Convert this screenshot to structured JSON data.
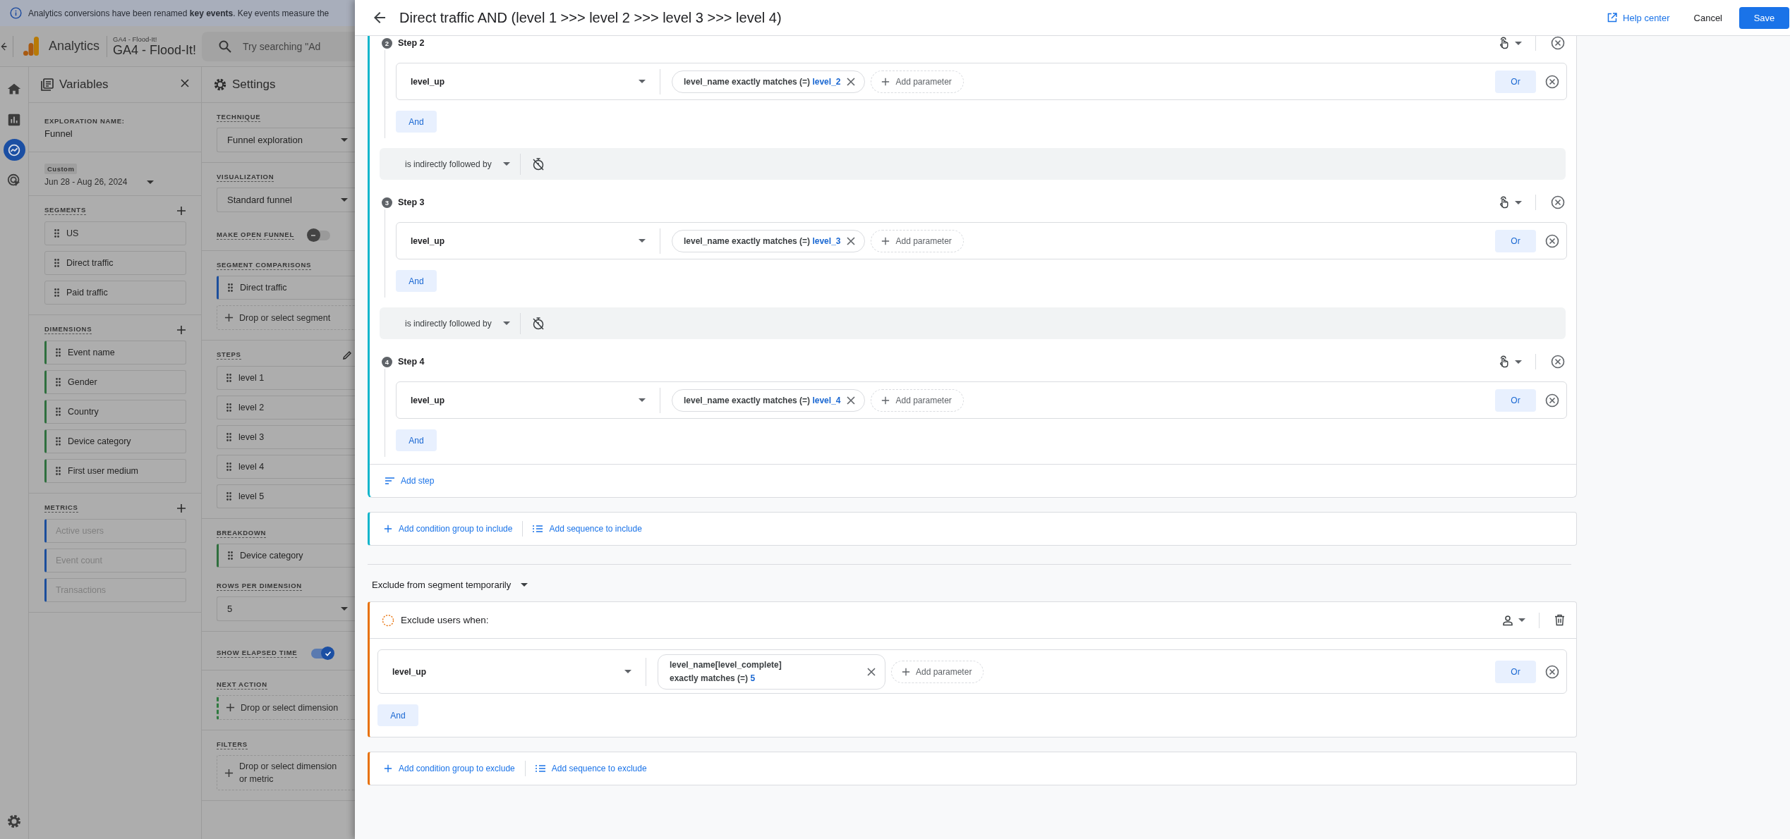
{
  "banner": {
    "text": "Analytics conversions have been renamed **key events**. Key events measure the"
  },
  "app_header": {
    "product": "Analytics",
    "property_caption": "GA4 - Flood-It!",
    "property": "GA4 - Flood-It!",
    "search": {
      "placeholder": "Try searching \"Ad"
    }
  },
  "rail": {
    "items": [
      {
        "kind": "home",
        "selected": false
      },
      {
        "kind": "reports",
        "selected": false
      },
      {
        "kind": "explore",
        "selected": true
      },
      {
        "kind": "advertising",
        "selected": false
      }
    ]
  },
  "variables_panel": {
    "title": "Variables",
    "exploration_name_label": "EXPLORATION NAME:",
    "exploration_name": "Funnel",
    "date_range": {
      "badge": "Custom",
      "value": "Jun 28 - Aug 26, 2024"
    },
    "segments": {
      "label": "SEGMENTS",
      "items": [
        "US",
        "Direct traffic",
        "Paid traffic"
      ]
    },
    "dimensions": {
      "label": "DIMENSIONS",
      "items": [
        "Event name",
        "Gender",
        "Country",
        "Device category",
        "First user medium"
      ]
    },
    "metrics": {
      "label": "METRICS",
      "items": [
        {
          "label": "Active users",
          "disabled": true
        },
        {
          "label": "Event count",
          "disabled": true
        },
        {
          "label": "Transactions",
          "disabled": true
        }
      ]
    }
  },
  "settings_panel": {
    "title": "Settings",
    "technique": {
      "label": "TECHNIQUE",
      "value": "Funnel exploration"
    },
    "visualization": {
      "label": "VISUALIZATION",
      "value": "Standard funnel"
    },
    "open_funnel": {
      "label": "MAKE OPEN FUNNEL",
      "on": false
    },
    "segment_comparisons": {
      "label": "SEGMENT COMPARISONS",
      "items": [
        "Direct traffic"
      ],
      "drop_target": "Drop or select segment"
    },
    "steps": {
      "label": "STEPS",
      "items": [
        "level 1",
        "level 2",
        "level 3",
        "level 4",
        "level 5"
      ]
    },
    "breakdown": {
      "label": "BREAKDOWN",
      "items": [
        "Device category"
      ]
    },
    "rows_per_dimension": {
      "label": "ROWS PER DIMENSION",
      "value": "5"
    },
    "elapsed_time": {
      "label": "SHOW ELAPSED TIME",
      "on": true
    },
    "next_action": {
      "label": "NEXT ACTION",
      "drop_target": "Drop or select dimension"
    },
    "filters": {
      "label": "FILTERS",
      "drop_target": "Drop or select dimension or metric"
    }
  },
  "editor": {
    "title": "Direct traffic AND (level 1 >>> level 2 >>> level 3 >>> level 4)",
    "help": "Help center",
    "cancel": "Cancel",
    "save": "Save",
    "include_sequence": {
      "steps": [
        {
          "number": "2",
          "label": "Step 2",
          "event": "level_up",
          "condition": {
            "text": "level_name exactly matches (=)",
            "value": "level_2"
          },
          "add_parameter": "Add parameter",
          "or": "Or",
          "and": "And",
          "connector": "is indirectly followed by"
        },
        {
          "number": "3",
          "label": "Step 3",
          "event": "level_up",
          "condition": {
            "text": "level_name exactly matches (=)",
            "value": "level_3"
          },
          "add_parameter": "Add parameter",
          "or": "Or",
          "and": "And",
          "connector": "is indirectly followed by"
        },
        {
          "number": "4",
          "label": "Step 4",
          "event": "level_up",
          "condition": {
            "text": "level_name exactly matches (=)",
            "value": "level_4"
          },
          "add_parameter": "Add parameter",
          "or": "Or",
          "and": "And"
        }
      ],
      "add_step": "Add step"
    },
    "include_actions": [
      "Add condition group to include",
      "Add sequence to include"
    ],
    "exclude_mode": "Exclude from segment temporarily",
    "exclude_group": {
      "title": "Exclude users when:",
      "event": "level_up",
      "condition": {
        "parameter": "level_name[level_complete]",
        "operator": "exactly matches (=)",
        "value": "5"
      },
      "add_parameter": "Add parameter",
      "or": "Or",
      "and": "And"
    },
    "exclude_actions": [
      "Add condition group to exclude",
      "Add sequence to exclude"
    ]
  }
}
